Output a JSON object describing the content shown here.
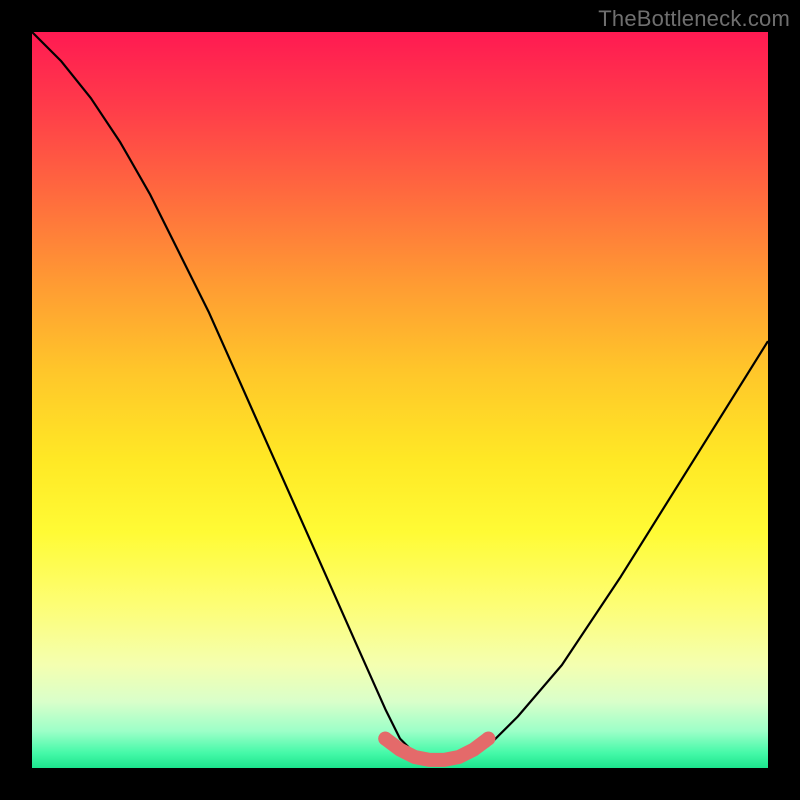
{
  "watermark": "TheBottleneck.com",
  "chart_data": {
    "type": "line",
    "title": "",
    "xlabel": "",
    "ylabel": "",
    "xlim": [
      0,
      100
    ],
    "ylim": [
      0,
      100
    ],
    "grid": false,
    "legend": false,
    "background_gradient": {
      "direction": "vertical",
      "stops": [
        {
          "pos": 0.0,
          "color": "#ff1a52"
        },
        {
          "pos": 0.5,
          "color": "#ffd228"
        },
        {
          "pos": 0.8,
          "color": "#fbff88"
        },
        {
          "pos": 1.0,
          "color": "#1ce48d"
        }
      ]
    },
    "series": [
      {
        "name": "bottleneck-curve",
        "x": [
          0,
          4,
          8,
          12,
          16,
          20,
          24,
          28,
          32,
          36,
          40,
          44,
          48,
          50,
          52,
          54,
          56,
          58,
          60,
          62,
          66,
          72,
          80,
          90,
          100
        ],
        "y": [
          100,
          96,
          91,
          85,
          78,
          70,
          62,
          53,
          44,
          35,
          26,
          17,
          8,
          4,
          2,
          1,
          1,
          1,
          2,
          3,
          7,
          14,
          26,
          42,
          58
        ],
        "color": "#000000"
      }
    ],
    "highlight": {
      "name": "bottom-highlight",
      "color": "#e46a6a",
      "x": [
        48,
        50,
        52,
        54,
        56,
        58,
        60,
        62
      ],
      "y": [
        4,
        2.5,
        1.5,
        1.1,
        1.1,
        1.5,
        2.5,
        4
      ]
    }
  }
}
